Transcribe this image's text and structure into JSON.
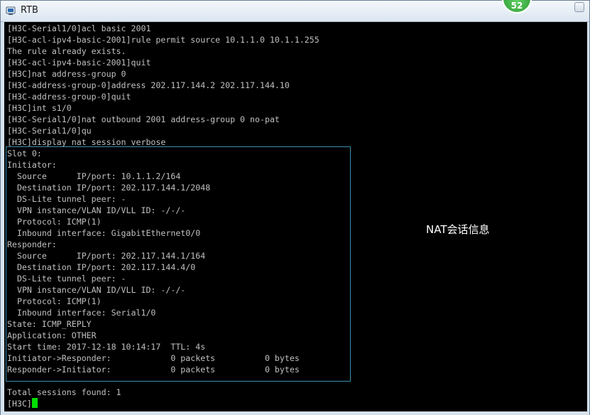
{
  "window": {
    "title": "RTB",
    "badge_count": "52"
  },
  "terminal": {
    "lines": [
      "[H3C-Serial1/0]acl basic 2001",
      "[H3C-acl-ipv4-basic-2001]rule permit source 10.1.1.0 10.1.1.255",
      "The rule already exists.",
      "[H3C-acl-ipv4-basic-2001]quit",
      "[H3C]nat address-group 0",
      "[H3C-address-group-0]address 202.117.144.2 202.117.144.10",
      "[H3C-address-group-0]quit",
      "[H3C]int s1/0",
      "[H3C-Serial1/0]nat outbound 2001 address-group 0 no-pat",
      "[H3C-Serial1/0]qu",
      "[H3C]display nat session verbose",
      "Slot 0:",
      "Initiator:",
      "  Source      IP/port: 10.1.1.2/164",
      "  Destination IP/port: 202.117.144.1/2048",
      "  DS-Lite tunnel peer: -",
      "  VPN instance/VLAN ID/VLL ID: -/-/-",
      "  Protocol: ICMP(1)",
      "  Inbound interface: GigabitEthernet0/0",
      "Responder:",
      "  Source      IP/port: 202.117.144.1/164",
      "  Destination IP/port: 202.117.144.4/0",
      "  DS-Lite tunnel peer: -",
      "  VPN instance/VLAN ID/VLL ID: -/-/-",
      "  Protocol: ICMP(1)",
      "  Inbound interface: Serial1/0",
      "State: ICMP_REPLY",
      "Application: OTHER",
      "Start time: 2017-12-18 10:14:17  TTL: 4s",
      "Initiator->Responder:            0 packets          0 bytes",
      "Responder->Initiator:            0 packets          0 bytes",
      "",
      "Total sessions found: 1"
    ],
    "prompt": "[H3C]"
  },
  "annotation": {
    "text": "NAT会话信息"
  },
  "colors": {
    "terminal_bg": "#000000",
    "terminal_text": "#c0c0c0",
    "cursor": "#00e000",
    "highlight_border": "#3d8fb0",
    "annotation_text": "#ffffff"
  }
}
